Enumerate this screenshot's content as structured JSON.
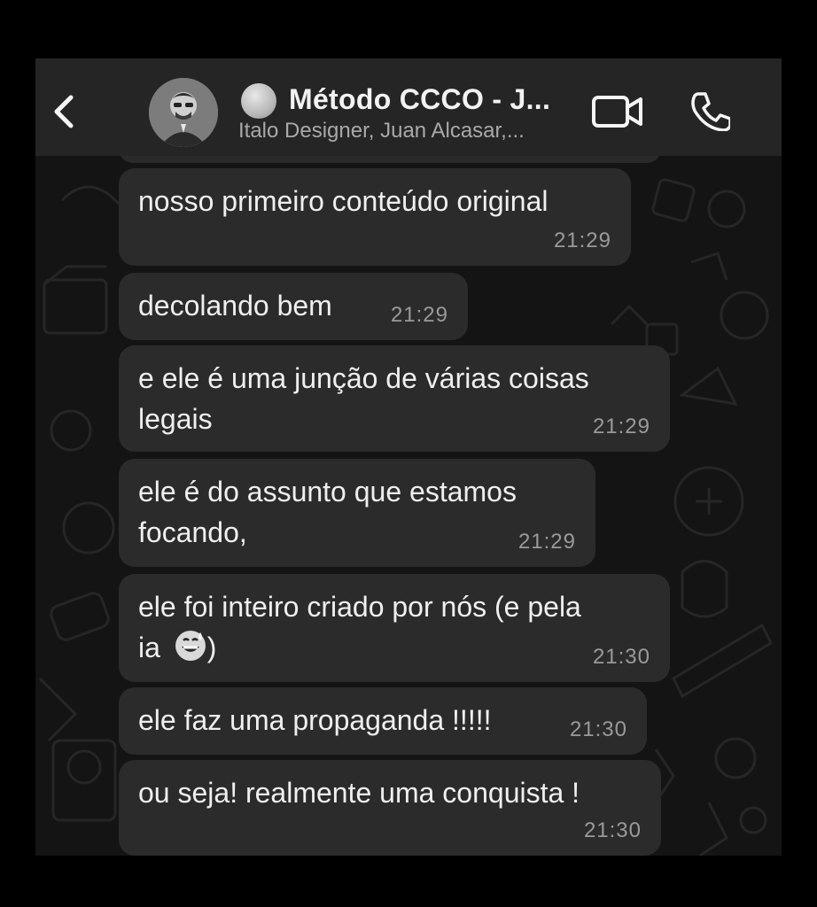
{
  "header": {
    "title": "Método CCCO - J...",
    "subtitle": "Italo Designer, Juan Alcasar,..."
  },
  "icons": {
    "back": "chevron-left-icon",
    "video": "video-camera-icon",
    "call": "phone-icon",
    "emoji": "grinning-sweat-emoji"
  },
  "colors": {
    "background": "#141414",
    "header": "#252525",
    "bubble": "#2b2b2b",
    "text": "#efefef",
    "time": "#9a9a9a"
  },
  "messages": [
    {
      "lines": [
        "nosso primeiro conteúdo original"
      ],
      "time": "21:29"
    },
    {
      "lines": [
        "decolando bem"
      ],
      "time": "21:29"
    },
    {
      "lines": [
        "e ele é uma junção de várias coisas",
        "legais"
      ],
      "time": "21:29"
    },
    {
      "lines": [
        "ele é do assunto que estamos",
        "focando,"
      ],
      "time": "21:29"
    },
    {
      "lines": [
        "ele foi inteiro criado por nós (e pela",
        "ia ",
        ")"
      ],
      "time": "21:30"
    },
    {
      "lines": [
        "ele faz uma propaganda !!!!!"
      ],
      "time": "21:30"
    },
    {
      "lines": [
        "ou seja! realmente uma conquista !"
      ],
      "time": "21:30"
    }
  ]
}
